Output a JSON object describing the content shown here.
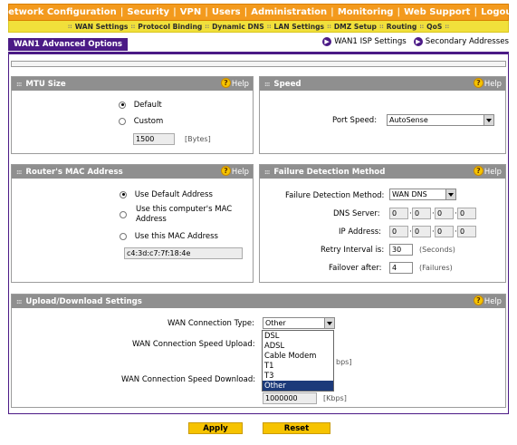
{
  "top_nav": [
    {
      "label": "Network Configuration"
    },
    {
      "label": "Security"
    },
    {
      "label": "VPN"
    },
    {
      "label": "Users"
    },
    {
      "label": "Administration"
    },
    {
      "label": "Monitoring"
    },
    {
      "label": "Web Support"
    },
    {
      "label": "Logout"
    }
  ],
  "sub_nav": [
    {
      "label": "WAN Settings"
    },
    {
      "label": "Protocol Binding"
    },
    {
      "label": "Dynamic DNS"
    },
    {
      "label": "LAN Settings"
    },
    {
      "label": "DMZ Setup"
    },
    {
      "label": "Routing"
    },
    {
      "label": "QoS"
    }
  ],
  "page_title": "WAN1 Advanced Options",
  "page_links": {
    "isp_settings": "WAN1 ISP Settings",
    "secondary": "Secondary Addresses"
  },
  "help_label": "Help",
  "mtu": {
    "title": "MTU Size",
    "default_label": "Default",
    "custom_label": "Custom",
    "value": "1500",
    "unit": "[Bytes]",
    "selected": "default"
  },
  "speed": {
    "title": "Speed",
    "port_speed_label": "Port Speed:",
    "port_speed_value": "AutoSense"
  },
  "mac": {
    "title": "Router's MAC Address",
    "opt_default": "Use Default Address",
    "opt_computer_line1": "Use this computer's MAC",
    "opt_computer_line2": "Address",
    "opt_custom": "Use this MAC Address",
    "custom_value": "c4:3d:c7:7f:18:4e",
    "selected": "default"
  },
  "failure": {
    "title": "Failure Detection Method",
    "method_label": "Failure Detection Method:",
    "method_value": "WAN DNS",
    "dns_label": "DNS Server:",
    "dns_octets": [
      "0",
      "0",
      "0",
      "0"
    ],
    "ip_label": "IP Address:",
    "ip_octets": [
      "0",
      "0",
      "0",
      "0"
    ],
    "retry_label": "Retry Interval is:",
    "retry_value": "30",
    "retry_unit": "(Seconds)",
    "failover_label": "Failover after:",
    "failover_value": "4",
    "failover_unit": "(Failures)"
  },
  "updown": {
    "title": "Upload/Download Settings",
    "conn_type_label": "WAN Connection Type:",
    "conn_type_value": "Other",
    "upload_label": "WAN Connection Speed Upload:",
    "upload_unit_partial": "bps]",
    "download_label": "WAN Connection Speed Download:",
    "download_value": "1000000",
    "download_unit": "[Kbps]",
    "dropdown_options": [
      "DSL",
      "ADSL",
      "Cable Modem",
      "T1",
      "T3",
      "Other"
    ],
    "dropdown_selected": "Other"
  },
  "buttons": {
    "apply": "Apply",
    "reset": "Reset"
  },
  "colors": {
    "nav_orange": "#f39a1d",
    "subnav_yellow": "#f1e03b",
    "brand_purple": "#4b1a86",
    "panel_header_gray": "#8f8f8f",
    "button_yellow": "#f6c300",
    "selection_blue": "#1c3a7a"
  }
}
